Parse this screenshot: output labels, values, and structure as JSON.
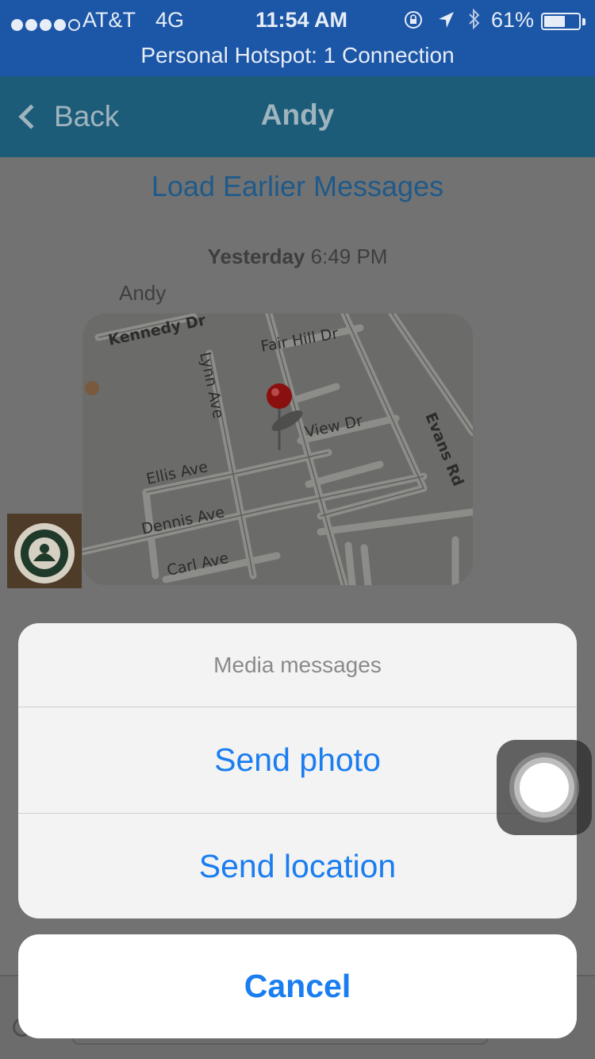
{
  "status_bar": {
    "carrier": "AT&T",
    "network": "4G",
    "time": "11:54 AM",
    "battery_percent": "61%",
    "battery_level": 0.61,
    "hotspot_text": "Personal Hotspot: 1 Connection",
    "icons": [
      "rotation-lock-icon",
      "location-arrow-icon",
      "bluetooth-icon"
    ]
  },
  "nav": {
    "back_label": "Back",
    "title": "Andy"
  },
  "chat": {
    "load_earlier": "Load Earlier Messages",
    "timestamp_day": "Yesterday",
    "timestamp_time": "6:49 PM",
    "sender": "Andy",
    "map_labels": {
      "kennedy": "Kennedy Dr",
      "fair_hill": "Fair Hill Dr",
      "lynn": "Lynn Ave",
      "view": "View Dr",
      "evans": "Evans Rd",
      "ellis": "Ellis Ave",
      "dennis": "Dennis Ave",
      "carl": "Carl Ave"
    }
  },
  "action_sheet": {
    "title": "Media messages",
    "send_photo": "Send photo",
    "send_location": "Send location",
    "cancel": "Cancel"
  },
  "colors": {
    "status_bar": "#1c56a6",
    "nav_bar": "#1d5c78",
    "ios_blue": "#1a7df0"
  }
}
